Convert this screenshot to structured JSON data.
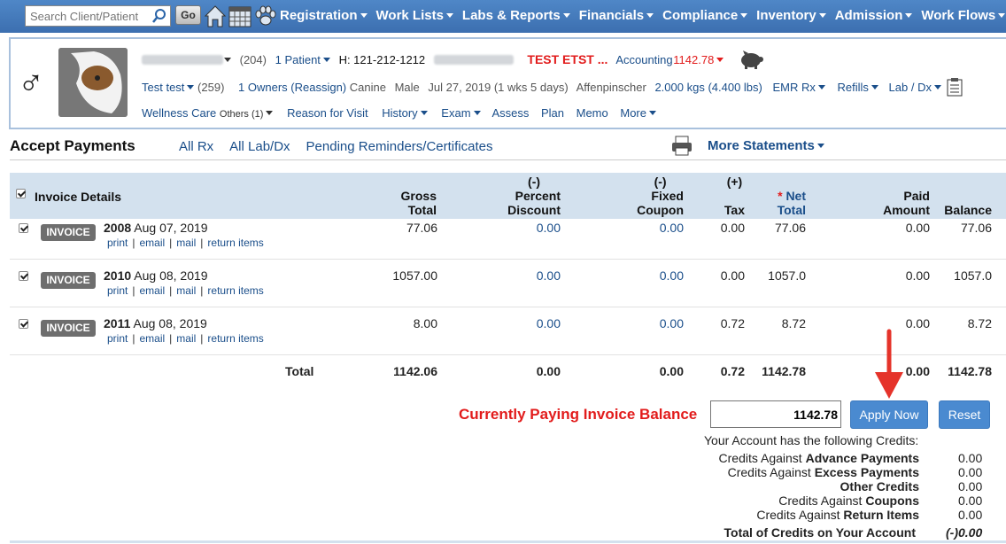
{
  "search": {
    "placeholder": "Search Client/Patient",
    "go_label": "Go"
  },
  "nav": {
    "items": [
      "Registration",
      "Work Lists",
      "Labs & Reports",
      "Financials",
      "Compliance",
      "Inventory",
      "Admission",
      "Work Flows"
    ]
  },
  "patient": {
    "client_count": "(204)",
    "patient_link": "1  Patient",
    "phone": "H: 121-212-1212",
    "alert": "TEST ETST ...",
    "accounting_label": "Accounting",
    "accounting_value": "1142.78",
    "name": "Test test",
    "id": "(259)",
    "owners": "1 Owners (Reassign)",
    "species": "Canine",
    "sex": "Male",
    "dob": "Jul 27, 2019 (1 wks 5 days)",
    "breed": "Affenpinscher",
    "weight": "2.000 kgs (4.400 lbs)",
    "emr": "EMR",
    "rx": "Rx",
    "refills": "Refills",
    "labdx": "Lab / Dx",
    "row3": {
      "wellness": "Wellness Care",
      "others": "Others (1)",
      "reason": "Reason for Visit",
      "history": "History",
      "exam": "Exam",
      "assess": "Assess",
      "plan": "Plan",
      "memo": "Memo",
      "more": "More"
    }
  },
  "section": {
    "title": "Accept Payments",
    "subnav": [
      "All Rx",
      "All Lab/Dx",
      "Pending Reminders/Certificates"
    ],
    "more_statements": "More Statements"
  },
  "table": {
    "headers": {
      "invoice_details": "Invoice Details",
      "gross": [
        "Gross",
        "Total"
      ],
      "percent": [
        "(-)",
        "Percent",
        "Discount"
      ],
      "fixed": [
        "(-)",
        "Fixed",
        "Coupon"
      ],
      "tax": [
        "(+)",
        "Tax"
      ],
      "net": [
        "* Net",
        "Total"
      ],
      "paid": [
        "Paid",
        "Amount"
      ],
      "balance": "Balance"
    },
    "badge": "INVOICE",
    "links": [
      "print",
      "email",
      "mail",
      "return items"
    ],
    "rows": [
      {
        "num": "2008",
        "date": "Aug 07, 2019",
        "gross": "77.06",
        "percent": "0.00",
        "fixed": "0.00",
        "tax": "0.00",
        "net": "77.06",
        "paid": "0.00",
        "balance": "77.06"
      },
      {
        "num": "2010",
        "date": "Aug 08, 2019",
        "gross": "1057.00",
        "percent": "0.00",
        "fixed": "0.00",
        "tax": "0.00",
        "net": "1057.0",
        "paid": "0.00",
        "balance": "1057.0"
      },
      {
        "num": "2011",
        "date": "Aug 08, 2019",
        "gross": "8.00",
        "percent": "0.00",
        "fixed": "0.00",
        "tax": "0.72",
        "net": "8.72",
        "paid": "0.00",
        "balance": "8.72"
      }
    ],
    "total": {
      "label": "Total",
      "gross": "1142.06",
      "percent": "0.00",
      "fixed": "0.00",
      "tax": "0.72",
      "net": "1142.78",
      "paid": "0.00",
      "balance": "1142.78"
    }
  },
  "payment": {
    "label": "Currently Paying Invoice Balance",
    "value": "1142.78",
    "apply": "Apply Now",
    "reset": "Reset"
  },
  "credits": {
    "intro": "Your Account has the following Credits:",
    "items": [
      {
        "prefix": "Credits Against ",
        "bold": "Advance Payments",
        "value": "0.00"
      },
      {
        "prefix": "Credits Against ",
        "bold": "Excess Payments",
        "value": "0.00"
      },
      {
        "prefix": "",
        "bold": "Other Credits",
        "value": "0.00"
      },
      {
        "prefix": "Credits Against ",
        "bold": "Coupons",
        "value": "0.00"
      },
      {
        "prefix": "Credits Against ",
        "bold": "Return Items",
        "value": "0.00"
      }
    ],
    "total_label": "Total of Credits on Your Account",
    "total_value": "(-)0.00"
  },
  "colors": {
    "nav_bg": "#3c6fb0",
    "table_header_bg": "#d3e1ee",
    "alert_red": "#e21c1c",
    "button_blue": "#4a8ad0"
  }
}
